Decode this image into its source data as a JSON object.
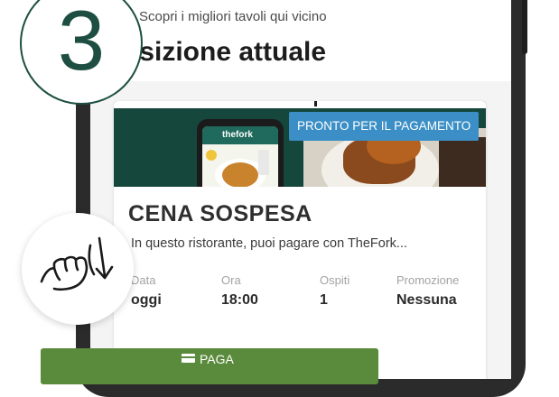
{
  "step": {
    "number": "3"
  },
  "header": {
    "subtitle": "Scopri i migliori tavoli qui vicino",
    "title": "osizione attuale"
  },
  "card": {
    "badge": "PRONTO PER IL PAGAMENTO",
    "mini_app_logo": "thefork",
    "title": "CENA SOSPESA",
    "description": "In questo ristorante, puoi pagare con TheFork...",
    "details": [
      {
        "label": "Data",
        "value": "oggi"
      },
      {
        "label": "Ora",
        "value": "18:00"
      },
      {
        "label": "Ospiti",
        "value": "1"
      },
      {
        "label": "Promozione",
        "value": "Nessuna"
      }
    ],
    "pay_button": {
      "label": "PAGA",
      "icon": "credit-card-icon"
    }
  },
  "gesture": {
    "icon": "swipe-down-hand-icon"
  },
  "colors": {
    "brand_green": "#1d4e41",
    "banner_green": "#15473d",
    "badge_blue": "#3b8fc6",
    "button_green": "#5a8a3c"
  }
}
